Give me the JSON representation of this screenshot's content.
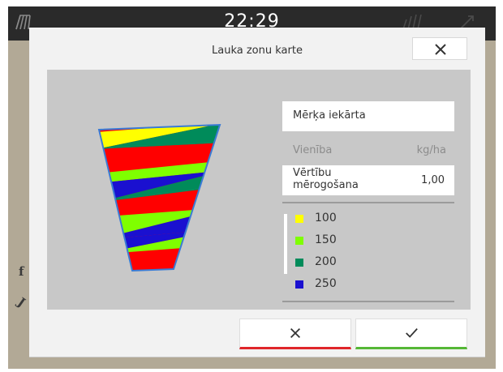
{
  "statusbar": {
    "clock": "22:29"
  },
  "side": {
    "glyph_top": "f",
    "glyph_bottom": "J"
  },
  "dialog": {
    "title": "Lauka zonu karte",
    "close_icon": "close-icon"
  },
  "panel": {
    "target_device": "Mērķa iekārta",
    "unit_label": "Vienība",
    "unit_value": "kg/ha",
    "scaling_label_line1": "Vērtību",
    "scaling_label_line2": "mērogošana",
    "scaling_value": "1,00"
  },
  "legend": [
    {
      "value": "100",
      "color": "#ffff00"
    },
    {
      "value": "150",
      "color": "#7fff00"
    },
    {
      "value": "200",
      "color": "#008b5a"
    },
    {
      "value": "250",
      "color": "#1a10d0"
    }
  ],
  "zone_colors": [
    "#ffff00",
    "#7fff00",
    "#008b5a",
    "#1a10d0",
    "#ff0000"
  ],
  "buttons": {
    "cancel_icon": "close-icon",
    "confirm_icon": "checkmark-icon"
  }
}
